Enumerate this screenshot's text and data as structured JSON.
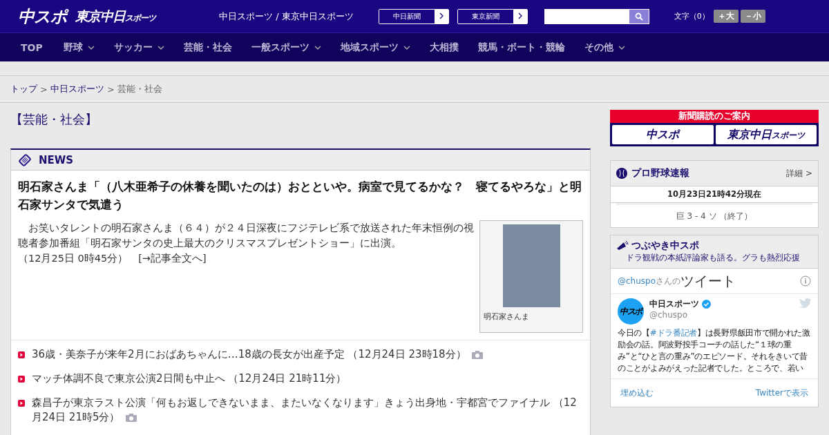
{
  "header": {
    "logo_primary": "中スポ",
    "logo_secondary": "東京中日",
    "logo_secondary_sub": "スポーツ",
    "site_name": "中日スポーツ / 東京中日スポーツ",
    "paper_links": [
      "中日新聞",
      "東京新聞"
    ],
    "font_size": {
      "label": "文字（0）",
      "buttons": [
        "＋大",
        "－小"
      ]
    }
  },
  "nav": [
    {
      "label": "TOP",
      "dropdown": false
    },
    {
      "label": "野球",
      "dropdown": true
    },
    {
      "label": "サッカー",
      "dropdown": true
    },
    {
      "label": "芸能・社会",
      "dropdown": false
    },
    {
      "label": "一般スポーツ",
      "dropdown": true
    },
    {
      "label": "地域スポーツ",
      "dropdown": true
    },
    {
      "label": "大相撲",
      "dropdown": false
    },
    {
      "label": "競馬・ボート・競輪",
      "dropdown": false
    },
    {
      "label": "その他",
      "dropdown": true
    }
  ],
  "breadcrumb": {
    "separator": ">",
    "items": [
      {
        "label": "トップ",
        "link": true
      },
      {
        "label": "中日スポーツ",
        "link": true
      },
      {
        "label": "芸能・社会",
        "link": false
      }
    ]
  },
  "section_title": "【芸能・社会】",
  "news": {
    "heading": "NEWS",
    "lead": {
      "title": "明石家さんま「（八木亜希子の休養を聞いたのは）おとといや。病室で見てるかな？　寝てるやろな」と明石家サンタで気遣う",
      "body": "　お笑いタレントの明石家さんま（６４）が２４日深夜にフジテレビ系で放送された年末恒例の視聴者参加番組「明石家サンタの史上最大のクリスマスプレゼントショー」に出演。",
      "time": "（12月25日 0時45分）",
      "more_link": "[→記事全文へ]",
      "photo_caption": "明石家さんま"
    },
    "items": [
      {
        "text": "36歳・美奈子が来年2月におばあちゃんに…18歳の長女が出産予定",
        "time": "（12月24日 23時18分）",
        "has_photo": true
      },
      {
        "text": "マッチ体調不良で東京公演2日間も中止へ",
        "time": "（12月24日 21時11分）",
        "has_photo": false
      },
      {
        "text": "森昌子が東京ラスト公演「何もお返しできないまま、またいなくなります」きょう出身地・宇都宮でファイナル",
        "time": "（12月24日 21時5分）",
        "has_photo": true
      }
    ]
  },
  "sidebar": {
    "subscription": {
      "title": "新聞購読のご案内",
      "logos": [
        "中スポ",
        "東京中日"
      ],
      "logo_sub": "スポーツ"
    },
    "baseball": {
      "title": "プロ野球速報",
      "detail_link": "詳細 >",
      "updated": "10月23日21時42分現在",
      "score": "巨 3 - 4 ソ （終了）"
    },
    "tweets": {
      "title": "つぶやき中スポ",
      "subtitle": "ドラ観戦の本紙評論家も語る。グラも熱烈応援",
      "handle": "@chuspo",
      "handle_suffix": "さんの",
      "header_title": "ツイート",
      "tweet": {
        "name": "中日スポーツ",
        "verified": true,
        "handle": "@chuspo",
        "avatar_text": "中スポ",
        "body_before": "今日の【",
        "hashtag": "#ドラ番記者",
        "body_after": "】は長野県飯田市で開かれた激励会の話。阿波野投手コーチの話した“１球の重み”と“ひと言の重み”のエピソード。それをきいて昔のことがよみがえった記者でした。ところで、若い"
      },
      "footer_links": [
        "埋め込む",
        "Twitterで表示"
      ]
    }
  }
}
